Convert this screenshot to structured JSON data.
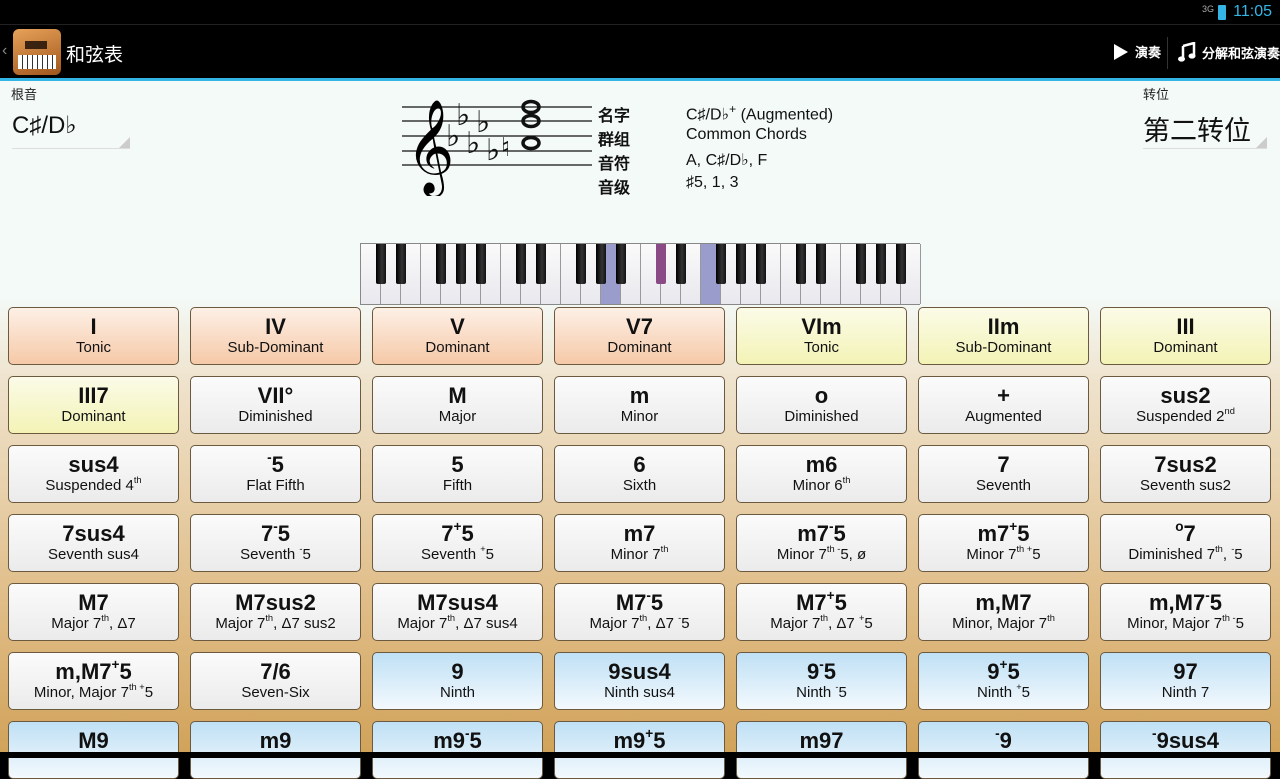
{
  "status_bar": {
    "time": "11:05",
    "network": "3G"
  },
  "action_bar": {
    "title": "和弦表",
    "play_label": "演奏",
    "arpeggio_label": "分解和弦演奏",
    "play_icon": "play-icon",
    "arpeggio_icon": "music-note-icon"
  },
  "root": {
    "label": "根音",
    "value": "C♯/D♭"
  },
  "inversion": {
    "label": "转位",
    "value": "第二转位"
  },
  "info": {
    "name_label": "名字",
    "name_value": "C♯/D♭",
    "name_sup": "+",
    "name_suffix": " (Augmented)",
    "group_label": "群组",
    "group_value": "Common Chords",
    "notes_label": "音符",
    "notes_value": "A, C♯/D♭, F",
    "degree_label": "音级",
    "degree_value": "♯5, 1, 3"
  },
  "keyboard": {
    "octaves": 4,
    "start_note": "C",
    "highlighted_keys": [
      "A",
      "C♯",
      "F"
    ],
    "highlight_color": "#9a9ccb",
    "black_highlight_color": "#8a4a86"
  },
  "colors": {
    "accent": "#33b5e5",
    "orange": "#f6c9a8",
    "yellow": "#f3f3b6",
    "blue": "#bfe0f5"
  },
  "chords": [
    {
      "name": [
        "I"
      ],
      "desc": [
        "Tonic"
      ],
      "style": "o"
    },
    {
      "name": [
        "IV"
      ],
      "desc": [
        "Sub-Dominant"
      ],
      "style": "o"
    },
    {
      "name": [
        "V"
      ],
      "desc": [
        "Dominant"
      ],
      "style": "o"
    },
    {
      "name": [
        "V7"
      ],
      "desc": [
        "Dominant"
      ],
      "style": "o"
    },
    {
      "name": [
        "VIm"
      ],
      "desc": [
        "Tonic"
      ],
      "style": "y"
    },
    {
      "name": [
        "IIm"
      ],
      "desc": [
        "Sub-Dominant"
      ],
      "style": "y"
    },
    {
      "name": [
        "III"
      ],
      "desc": [
        "Dominant"
      ],
      "style": "y"
    },
    {
      "name": [
        "III7"
      ],
      "desc": [
        "Dominant"
      ],
      "style": "y"
    },
    {
      "name": [
        "VII°"
      ],
      "desc": [
        "Diminished"
      ],
      "style": "w"
    },
    {
      "name": [
        "M"
      ],
      "desc": [
        "Major"
      ],
      "style": "w"
    },
    {
      "name": [
        "m"
      ],
      "desc": [
        "Minor"
      ],
      "style": "w"
    },
    {
      "name": [
        "o"
      ],
      "desc": [
        "Diminished"
      ],
      "style": "w"
    },
    {
      "name": [
        "+"
      ],
      "desc": [
        "Augmented"
      ],
      "style": "w"
    },
    {
      "name": [
        "sus2"
      ],
      "desc": [
        "Suspended 2",
        "^nd"
      ],
      "style": "w"
    },
    {
      "name": [
        "sus4"
      ],
      "desc": [
        "Suspended 4",
        "^th"
      ],
      "style": "w"
    },
    {
      "name": [
        "^-",
        "5"
      ],
      "desc": [
        "Flat Fifth"
      ],
      "style": "w"
    },
    {
      "name": [
        "5"
      ],
      "desc": [
        "Fifth"
      ],
      "style": "w"
    },
    {
      "name": [
        "6"
      ],
      "desc": [
        "Sixth"
      ],
      "style": "w"
    },
    {
      "name": [
        "m6"
      ],
      "desc": [
        "Minor 6",
        "^th"
      ],
      "style": "w"
    },
    {
      "name": [
        "7"
      ],
      "desc": [
        "Seventh"
      ],
      "style": "w"
    },
    {
      "name": [
        "7sus2"
      ],
      "desc": [
        "Seventh sus2"
      ],
      "style": "w"
    },
    {
      "name": [
        "7sus4"
      ],
      "desc": [
        "Seventh sus4"
      ],
      "style": "w"
    },
    {
      "name": [
        "7",
        "^-",
        "5"
      ],
      "desc": [
        "Seventh ",
        "^-",
        "5"
      ],
      "style": "w"
    },
    {
      "name": [
        "7",
        "^+",
        "5"
      ],
      "desc": [
        "Seventh ",
        "^+",
        "5"
      ],
      "style": "w"
    },
    {
      "name": [
        "m7"
      ],
      "desc": [
        "Minor 7",
        "^th"
      ],
      "style": "w"
    },
    {
      "name": [
        "m7",
        "^-",
        "5"
      ],
      "desc": [
        "Minor 7",
        "^th -",
        "5, ø"
      ],
      "style": "w"
    },
    {
      "name": [
        "m7",
        "^+",
        "5"
      ],
      "desc": [
        "Minor 7",
        "^th +",
        "5"
      ],
      "style": "w"
    },
    {
      "name": [
        "^o",
        "7"
      ],
      "desc": [
        "Diminished 7",
        "^th",
        ", ",
        "^-",
        "5"
      ],
      "style": "w"
    },
    {
      "name": [
        "M7"
      ],
      "desc": [
        "Major 7",
        "^th",
        ", Δ7"
      ],
      "style": "w"
    },
    {
      "name": [
        "M7sus2"
      ],
      "desc": [
        "Major 7",
        "^th",
        ", Δ7 sus2"
      ],
      "style": "w"
    },
    {
      "name": [
        "M7sus4"
      ],
      "desc": [
        "Major 7",
        "^th",
        ", Δ7 sus4"
      ],
      "style": "w"
    },
    {
      "name": [
        "M7",
        "^-",
        "5"
      ],
      "desc": [
        "Major 7",
        "^th",
        ", Δ7 ",
        "^-",
        "5"
      ],
      "style": "w"
    },
    {
      "name": [
        "M7",
        "^+",
        "5"
      ],
      "desc": [
        "Major 7",
        "^th",
        ", Δ7 ",
        "^+",
        "5"
      ],
      "style": "w"
    },
    {
      "name": [
        "m,M7"
      ],
      "desc": [
        "Minor, Major 7",
        "^th"
      ],
      "style": "w"
    },
    {
      "name": [
        "m,M7",
        "^-",
        "5"
      ],
      "desc": [
        "Minor, Major 7",
        "^th -",
        "5"
      ],
      "style": "w"
    },
    {
      "name": [
        "m,M7",
        "^+",
        "5"
      ],
      "desc": [
        "Minor, Major 7",
        "^th +",
        "5"
      ],
      "style": "w"
    },
    {
      "name": [
        "7/6"
      ],
      "desc": [
        "Seven-Six"
      ],
      "style": "w"
    },
    {
      "name": [
        "9"
      ],
      "desc": [
        "Ninth"
      ],
      "style": "b"
    },
    {
      "name": [
        "9sus4"
      ],
      "desc": [
        "Ninth sus4"
      ],
      "style": "b"
    },
    {
      "name": [
        "9",
        "^-",
        "5"
      ],
      "desc": [
        "Ninth ",
        "^-",
        "5"
      ],
      "style": "b"
    },
    {
      "name": [
        "9",
        "^+",
        "5"
      ],
      "desc": [
        "Ninth ",
        "^+",
        "5"
      ],
      "style": "b"
    },
    {
      "name": [
        "97"
      ],
      "desc": [
        "Ninth 7"
      ],
      "style": "b"
    },
    {
      "name": [
        "M9"
      ],
      "desc": [],
      "style": "b"
    },
    {
      "name": [
        "m9"
      ],
      "desc": [],
      "style": "b"
    },
    {
      "name": [
        "m9",
        "^-",
        "5"
      ],
      "desc": [],
      "style": "b"
    },
    {
      "name": [
        "m9",
        "^+",
        "5"
      ],
      "desc": [],
      "style": "b"
    },
    {
      "name": [
        "m97"
      ],
      "desc": [],
      "style": "b"
    },
    {
      "name": [
        "^-",
        "9"
      ],
      "desc": [],
      "style": "b"
    },
    {
      "name": [
        "^-",
        "9sus4"
      ],
      "desc": [],
      "style": "b"
    }
  ]
}
